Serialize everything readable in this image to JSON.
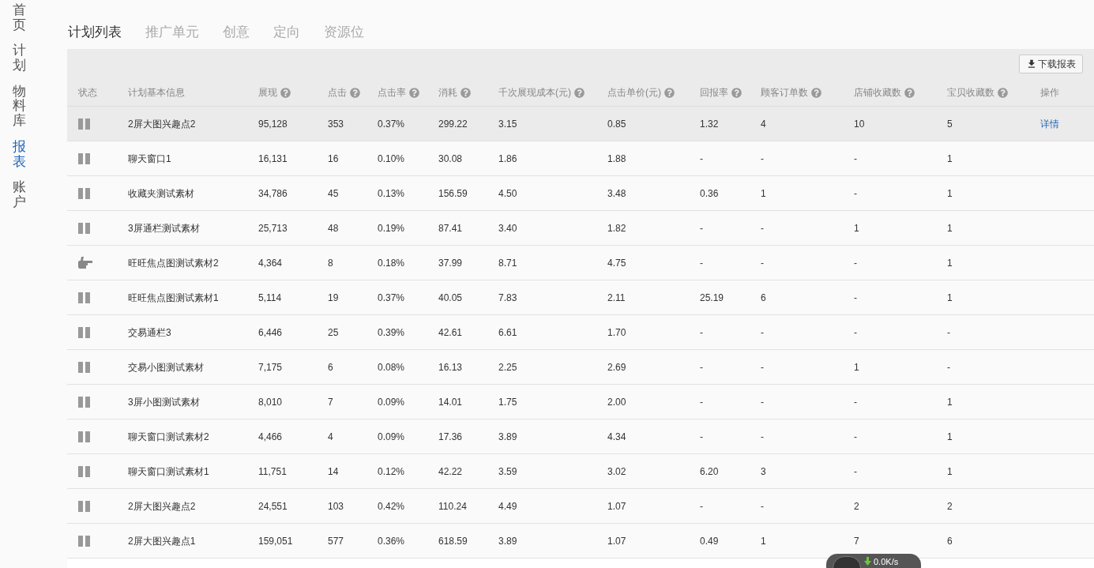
{
  "sidebar": {
    "items": [
      {
        "label": "首页",
        "selected": false
      },
      {
        "label": "计划",
        "selected": false
      },
      {
        "label": "物料库",
        "selected": false
      },
      {
        "label": "报表",
        "selected": true
      },
      {
        "label": "账户",
        "selected": false
      }
    ]
  },
  "tabs": [
    {
      "label": "计划列表",
      "selected": true
    },
    {
      "label": "推广单元",
      "selected": false
    },
    {
      "label": "创意",
      "selected": false
    },
    {
      "label": "定向",
      "selected": false
    },
    {
      "label": "资源位",
      "selected": false
    }
  ],
  "download_button": "下载报表",
  "table": {
    "status_header": "状态",
    "columns": [
      {
        "label": "计划基本信息",
        "help": false
      },
      {
        "label": "展现",
        "help": true
      },
      {
        "label": "点击",
        "help": true
      },
      {
        "label": "点击率",
        "help": true
      },
      {
        "label": "消耗",
        "help": true
      },
      {
        "label": "千次展现成本(元)",
        "help": true
      },
      {
        "label": "点击单价(元)",
        "help": true
      },
      {
        "label": "回报率",
        "help": true
      },
      {
        "label": "顾客订单数",
        "help": true
      },
      {
        "label": "店铺收藏数",
        "help": true
      },
      {
        "label": "宝贝收藏数",
        "help": true
      }
    ],
    "action_header": "操作",
    "rows": [
      {
        "kind": "paused",
        "selected": true,
        "cells": [
          "2屏大图兴趣点2",
          "95,128",
          "353",
          "0.37%",
          "299.22",
          "3.15",
          "0.85",
          "1.32",
          "4",
          "10",
          "5"
        ],
        "action": "详情"
      },
      {
        "kind": "paused",
        "selected": false,
        "cells": [
          "聊天窗口1",
          "16,131",
          "16",
          "0.10%",
          "30.08",
          "1.86",
          "1.88",
          "-",
          "-",
          "-",
          "1"
        ]
      },
      {
        "kind": "paused",
        "selected": false,
        "cells": [
          "收藏夹测试素材",
          "34,786",
          "45",
          "0.13%",
          "156.59",
          "4.50",
          "3.48",
          "0.36",
          "1",
          "-",
          "1"
        ]
      },
      {
        "kind": "paused",
        "selected": false,
        "cells": [
          "3屏通栏测试素材",
          "25,713",
          "48",
          "0.19%",
          "87.41",
          "3.40",
          "1.82",
          "-",
          "-",
          "1",
          "1"
        ]
      },
      {
        "kind": "pointer",
        "selected": false,
        "cells": [
          "旺旺焦点图测试素材2",
          "4,364",
          "8",
          "0.18%",
          "37.99",
          "8.71",
          "4.75",
          "-",
          "-",
          "-",
          "1"
        ]
      },
      {
        "kind": "paused",
        "selected": false,
        "cells": [
          "旺旺焦点图测试素材1",
          "5,114",
          "19",
          "0.37%",
          "40.05",
          "7.83",
          "2.11",
          "25.19",
          "6",
          "-",
          "1"
        ]
      },
      {
        "kind": "paused",
        "selected": false,
        "cells": [
          "交易通栏3",
          "6,446",
          "25",
          "0.39%",
          "42.61",
          "6.61",
          "1.70",
          "-",
          "-",
          "-",
          "-"
        ]
      },
      {
        "kind": "paused",
        "selected": false,
        "cells": [
          "交易小图测试素材",
          "7,175",
          "6",
          "0.08%",
          "16.13",
          "2.25",
          "2.69",
          "-",
          "-",
          "1",
          "-"
        ]
      },
      {
        "kind": "paused",
        "selected": false,
        "cells": [
          "3屏小图测试素材",
          "8,010",
          "7",
          "0.09%",
          "14.01",
          "1.75",
          "2.00",
          "-",
          "-",
          "-",
          "1"
        ]
      },
      {
        "kind": "paused",
        "selected": false,
        "cells": [
          "聊天窗口测试素材2",
          "4,466",
          "4",
          "0.09%",
          "17.36",
          "3.89",
          "4.34",
          "-",
          "-",
          "-",
          "1"
        ]
      },
      {
        "kind": "paused",
        "selected": false,
        "cells": [
          "聊天窗口测试素材1",
          "11,751",
          "14",
          "0.12%",
          "42.22",
          "3.59",
          "3.02",
          "6.20",
          "3",
          "-",
          "1"
        ]
      },
      {
        "kind": "paused",
        "selected": false,
        "cells": [
          "2屏大图兴趣点2",
          "24,551",
          "103",
          "0.42%",
          "110.24",
          "4.49",
          "1.07",
          "-",
          "-",
          "2",
          "2"
        ]
      },
      {
        "kind": "paused",
        "selected": false,
        "cells": [
          "2屏大图兴趣点1",
          "159,051",
          "577",
          "0.36%",
          "618.59",
          "3.89",
          "1.07",
          "0.49",
          "1",
          "7",
          "6"
        ]
      }
    ]
  },
  "speed_widget": {
    "text": "0.0K/s"
  }
}
